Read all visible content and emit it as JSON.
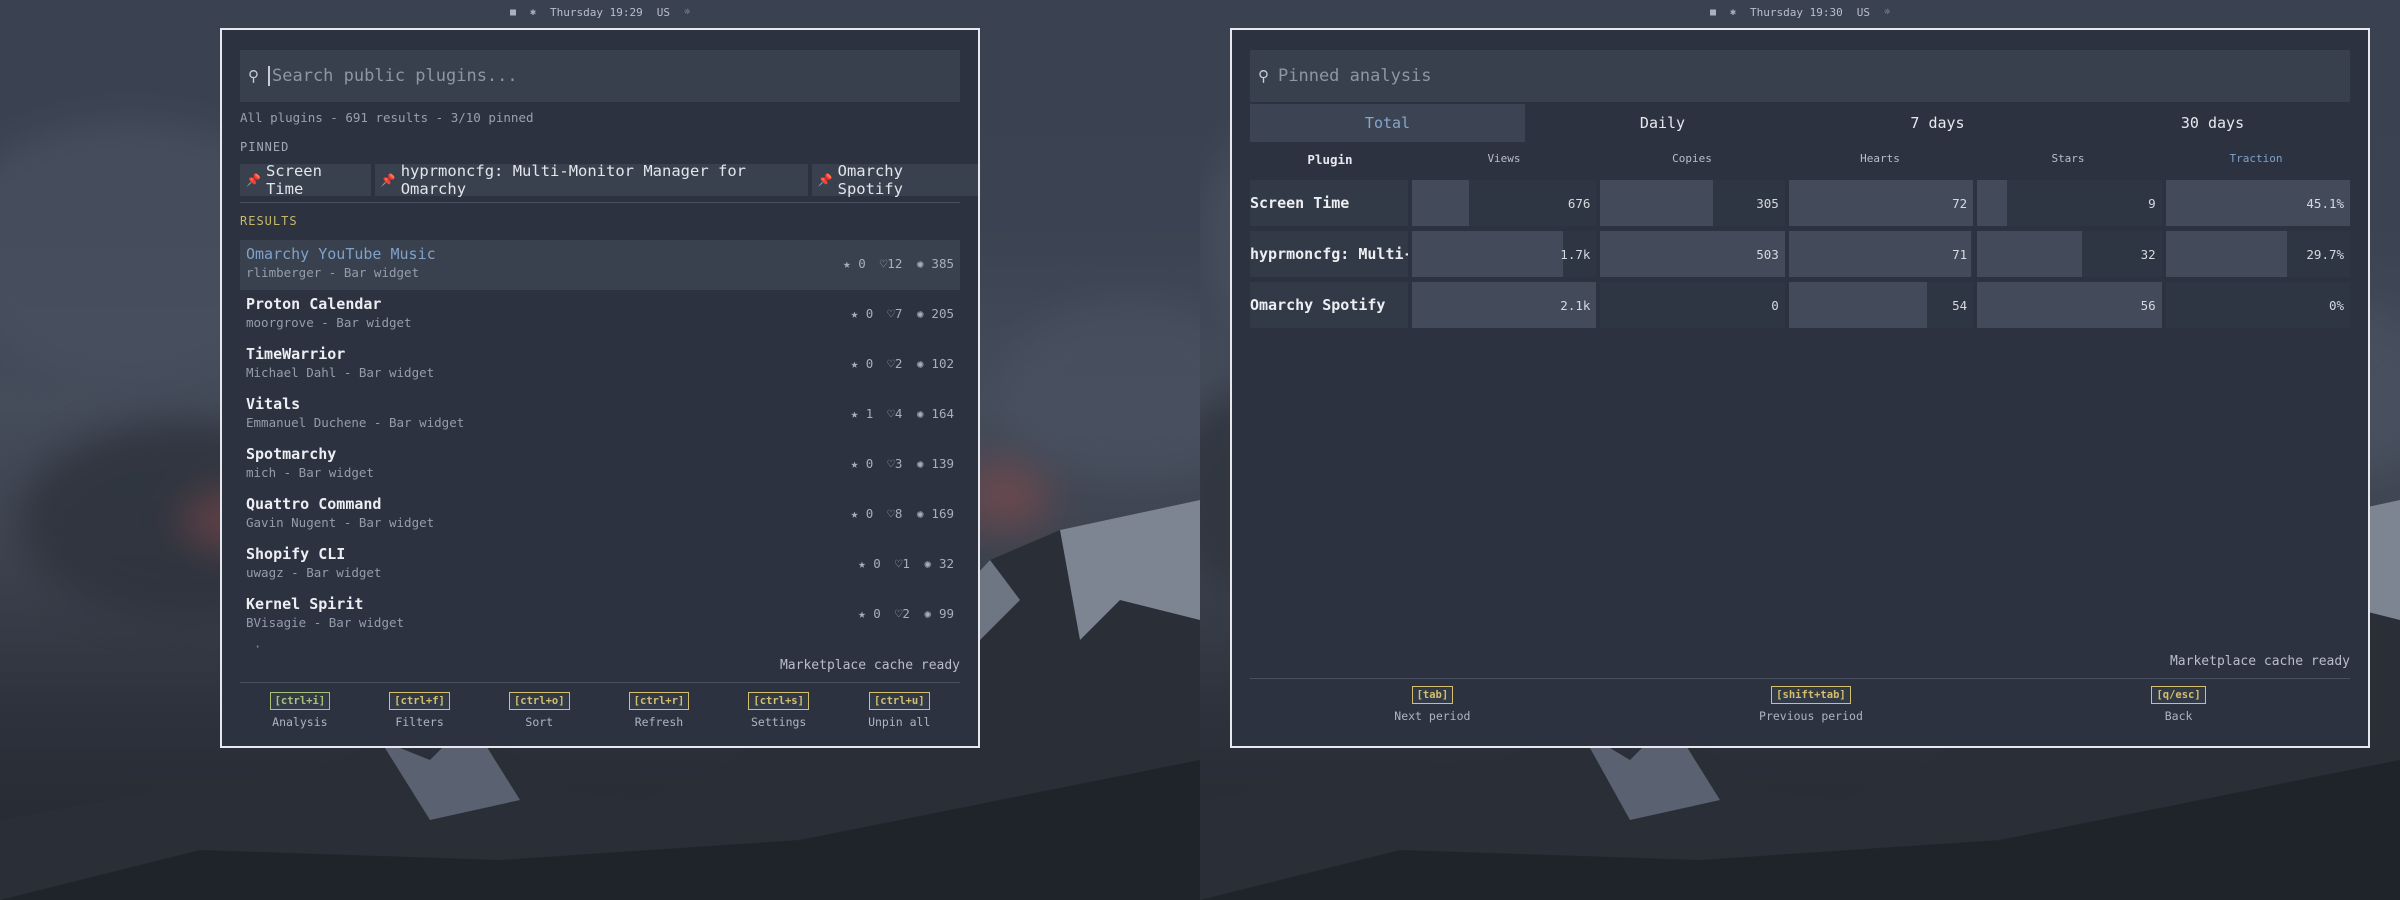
{
  "left_screen": {
    "topbar": {
      "day_time": "Thursday 19:29",
      "lang": "US"
    },
    "search": {
      "placeholder": "Search public plugins..."
    },
    "summary": "All plugins  -  691 results  -  3/10 pinned",
    "pinned_label": "PINNED",
    "pinned": [
      "Screen Time",
      "hyprmoncfg: Multi-Monitor Manager for Omarchy",
      "Omarchy Spotify"
    ],
    "results_label": "RESULTS",
    "results": [
      {
        "name": "Omarchy YouTube Music",
        "sub": "rlimberger  -  Bar widget",
        "stars": "0",
        "hearts": "12",
        "views": "385"
      },
      {
        "name": "Proton Calendar",
        "sub": "moorgrove  -  Bar widget",
        "stars": "0",
        "hearts": "7",
        "views": "205"
      },
      {
        "name": "TimeWarrior",
        "sub": "Michael Dahl  -  Bar widget",
        "stars": "0",
        "hearts": "2",
        "views": "102"
      },
      {
        "name": "Vitals",
        "sub": "Emmanuel Duchene  -  Bar widget",
        "stars": "1",
        "hearts": "4",
        "views": "164"
      },
      {
        "name": "Spotmarchy",
        "sub": "mich  -  Bar widget",
        "stars": "0",
        "hearts": "3",
        "views": "139"
      },
      {
        "name": "Quattro Command",
        "sub": "Gavin Nugent  -  Bar widget",
        "stars": "0",
        "hearts": "8",
        "views": "169"
      },
      {
        "name": "Shopify CLI",
        "sub": "uwagz  -  Bar widget",
        "stars": "0",
        "hearts": "1",
        "views": "32"
      },
      {
        "name": "Kernel Spirit",
        "sub": "BVisagie  -  Bar widget",
        "stars": "0",
        "hearts": "2",
        "views": "99"
      }
    ],
    "more_indicator": "·",
    "cache_status": "Marketplace cache ready",
    "footer": [
      {
        "key": "[ctrl+i]",
        "label": "Analysis"
      },
      {
        "key": "[ctrl+f]",
        "label": "Filters"
      },
      {
        "key": "[ctrl+o]",
        "label": "Sort"
      },
      {
        "key": "[ctrl+r]",
        "label": "Refresh"
      },
      {
        "key": "[ctrl+s]",
        "label": "Settings"
      },
      {
        "key": "[ctrl+u]",
        "label": "Unpin all"
      }
    ]
  },
  "right_screen": {
    "topbar": {
      "day_time": "Thursday 19:30",
      "lang": "US"
    },
    "search": {
      "placeholder": "Pinned analysis"
    },
    "tabs": [
      "Total",
      "Daily",
      "7 days",
      "30 days"
    ],
    "active_tab": "Total",
    "columns": [
      "Plugin",
      "Views",
      "Copies",
      "Hearts",
      "Stars",
      "Traction"
    ],
    "rows": [
      {
        "name": "Screen Time",
        "views": "676",
        "views_pct": 31,
        "copies": "305",
        "copies_pct": 61,
        "hearts": "72",
        "hearts_pct": 100,
        "stars": "9",
        "stars_pct": 16,
        "traction": "45.1%",
        "traction_pct": 100
      },
      {
        "name": "hyprmoncfg: Multi-…",
        "views": "1.7k",
        "views_pct": 82,
        "copies": "503",
        "copies_pct": 100,
        "hearts": "71",
        "hearts_pct": 99,
        "stars": "32",
        "stars_pct": 57,
        "traction": "29.7%",
        "traction_pct": 66
      },
      {
        "name": "Omarchy Spotify",
        "views": "2.1k",
        "views_pct": 100,
        "copies": "0",
        "copies_pct": 0,
        "hearts": "54",
        "hearts_pct": 75,
        "stars": "56",
        "stars_pct": 100,
        "traction": "0%",
        "traction_pct": 0
      }
    ],
    "cache_status": "Marketplace cache ready",
    "footer": [
      {
        "key": "[tab]",
        "label": "Next period"
      },
      {
        "key": "[shift+tab]",
        "label": "Previous period"
      },
      {
        "key": "[q/esc]",
        "label": "Back"
      }
    ]
  },
  "colors": {
    "accent_blue": "#7fa2c9",
    "key_yellow": "#d3bf6e",
    "key_green": "#a9c27a",
    "panel": "#2c3240"
  }
}
